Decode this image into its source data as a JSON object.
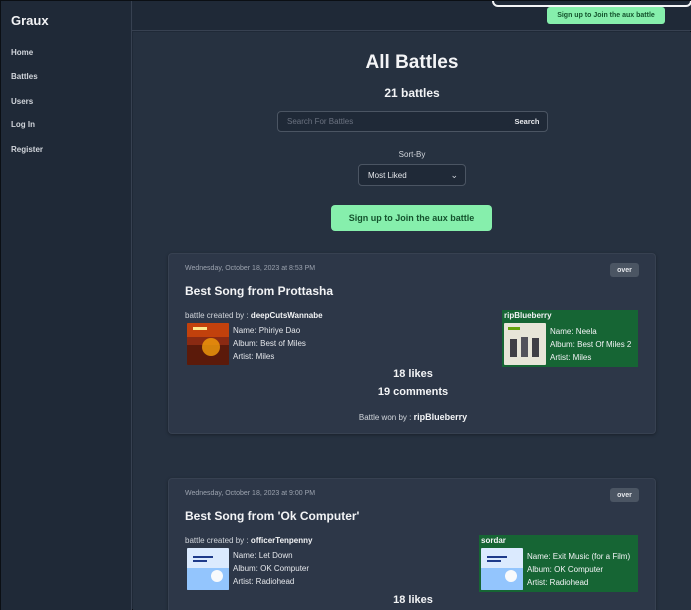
{
  "app": {
    "brand": "Graux"
  },
  "sidebar": {
    "items": [
      {
        "label": "Home"
      },
      {
        "label": "Battles"
      },
      {
        "label": "Users"
      },
      {
        "label": "Log In"
      },
      {
        "label": "Register"
      }
    ]
  },
  "topbar": {
    "cta_label": "Sign up to Join the aux battle"
  },
  "main": {
    "title": "All Battles",
    "count_label": "21 battles",
    "search": {
      "placeholder": "Search For Battles",
      "value": "",
      "button_label": "Search"
    },
    "sort": {
      "label": "Sort-By",
      "selected": "Most Liked"
    },
    "join_label": "Sign up to Join the aux battle"
  },
  "battles": [
    {
      "date": "Wednesday, October 18, 2023 at 8:53 PM",
      "status": "over",
      "title": "Best Song from Prottasha",
      "creator_prefix": "battle created by :",
      "creator": "deepCutsWannabe",
      "song_a": {
        "name": "Name: Phiriye Dao",
        "album": "Album: Best of Miles",
        "artist": "Artist: Miles"
      },
      "winner": {
        "user": "ripBlueberry",
        "name": "Name: Neela",
        "album": "Album: Best Of Miles 2",
        "artist": "Artist: Miles"
      },
      "likes": "18 likes",
      "comments": "19 comments",
      "won_by_prefix": "Battle won by :",
      "won_by": "ripBlueberry"
    },
    {
      "date": "Wednesday, October 18, 2023 at 9:00 PM",
      "status": "over",
      "title": "Best Song from 'Ok Computer'",
      "creator_prefix": "battle created by :",
      "creator": "officerTenpenny",
      "song_a": {
        "name": "Name: Let Down",
        "album": "Album: OK Computer",
        "artist": "Artist: Radiohead"
      },
      "winner": {
        "user": "sordar",
        "name": "Name: Exit Music (for a Film)",
        "album": "Album: OK Computer",
        "artist": "Artist: Radiohead"
      },
      "likes": "18 likes"
    }
  ],
  "colors": {
    "accent_green": "#86efac",
    "winner_green": "#166534",
    "card_bg": "#2d3748",
    "page_bg": "#263140"
  }
}
